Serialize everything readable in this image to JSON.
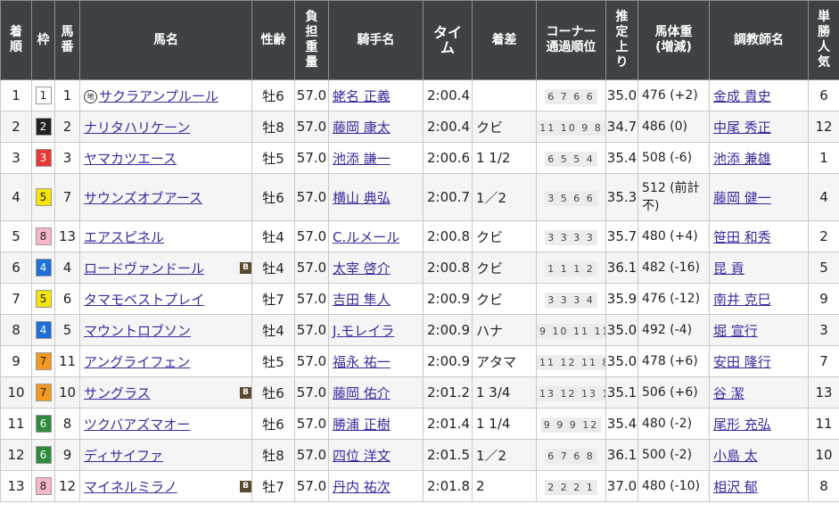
{
  "headers": {
    "finish": "着\n順",
    "waku": "枠",
    "number": "馬\n番",
    "horse": "馬名",
    "sexage": "性齢",
    "burden": "負\n担\n重\n量",
    "jockey": "騎手名",
    "time": "タイ\nム",
    "margin": "着差",
    "corner": "コーナー\n通過順位",
    "last3f": "推\n定\n上\nり",
    "bodyweight": "馬体重\n(増減)",
    "trainer": "調教師名",
    "pop": "単\n勝\n人\n気"
  },
  "icons": {
    "blinker_label": "B",
    "chihou_label": "地"
  },
  "waku_colors": {
    "1": {
      "bg": "#ffffff",
      "fg": "#222222"
    },
    "2": {
      "bg": "#222222",
      "fg": "#ffffff"
    },
    "3": {
      "bg": "#e53935",
      "fg": "#ffffff"
    },
    "4": {
      "bg": "#1e6fd9",
      "fg": "#ffffff"
    },
    "5": {
      "bg": "#f5e30a",
      "fg": "#222222"
    },
    "6": {
      "bg": "#2e8b3c",
      "fg": "#ffffff"
    },
    "7": {
      "bg": "#f39a1e",
      "fg": "#222222"
    },
    "8": {
      "bg": "#f7b7c6",
      "fg": "#222222"
    }
  },
  "rows": [
    {
      "finish": "1",
      "waku": "1",
      "num": "1",
      "horse": "サクラアンプルール",
      "chihou": true,
      "blinker": false,
      "sexage": "牡6",
      "burden": "57.0",
      "jockey": "蛯名 正義",
      "time": "2:00.4",
      "margin": "",
      "corner": "6 7 6 6",
      "last3f": "35.0",
      "bw": "476 (+2)",
      "trainer": "金成 貴史",
      "pop": "6"
    },
    {
      "finish": "2",
      "waku": "2",
      "num": "2",
      "horse": "ナリタハリケーン",
      "chihou": false,
      "blinker": false,
      "sexage": "牡8",
      "burden": "57.0",
      "jockey": "藤岡 康太",
      "time": "2:00.4",
      "margin": "クビ",
      "corner": "11 10 9 8",
      "last3f": "34.7",
      "bw": "486 (0)",
      "trainer": "中尾 秀正",
      "pop": "12"
    },
    {
      "finish": "3",
      "waku": "3",
      "num": "3",
      "horse": "ヤマカツエース",
      "chihou": false,
      "blinker": false,
      "sexage": "牡5",
      "burden": "57.0",
      "jockey": "池添 謙一",
      "time": "2:00.6",
      "margin": "1 1/2",
      "corner": "6 5 5 4",
      "last3f": "35.4",
      "bw": "508 (-6)",
      "trainer": "池添 兼雄",
      "pop": "1"
    },
    {
      "finish": "4",
      "waku": "5",
      "num": "7",
      "horse": "サウンズオブアース",
      "chihou": false,
      "blinker": false,
      "sexage": "牡6",
      "burden": "57.0",
      "jockey": "横山 典弘",
      "time": "2:00.7",
      "margin": "1／2",
      "corner": "3 5 6 6",
      "last3f": "35.3",
      "bw": "512 (前計不)",
      "trainer": "藤岡 健一",
      "pop": "4"
    },
    {
      "finish": "5",
      "waku": "8",
      "num": "13",
      "horse": "エアスピネル",
      "chihou": false,
      "blinker": false,
      "sexage": "牡4",
      "burden": "57.0",
      "jockey": "C.ルメール",
      "time": "2:00.8",
      "margin": "クビ",
      "corner": "3 3 3 3",
      "last3f": "35.7",
      "bw": "480 (+4)",
      "trainer": "笹田 和秀",
      "pop": "2"
    },
    {
      "finish": "6",
      "waku": "4",
      "num": "4",
      "horse": "ロードヴァンドール",
      "chihou": false,
      "blinker": true,
      "sexage": "牡4",
      "burden": "57.0",
      "jockey": "太宰 啓介",
      "time": "2:00.8",
      "margin": "クビ",
      "corner": "1 1 1 2",
      "last3f": "36.1",
      "bw": "482 (-16)",
      "trainer": "昆 貢",
      "pop": "5"
    },
    {
      "finish": "7",
      "waku": "5",
      "num": "6",
      "horse": "タマモベストプレイ",
      "chihou": false,
      "blinker": false,
      "sexage": "牡7",
      "burden": "57.0",
      "jockey": "吉田 隼人",
      "time": "2:00.9",
      "margin": "クビ",
      "corner": "3 3 3 4",
      "last3f": "35.9",
      "bw": "476 (-12)",
      "trainer": "南井 克巳",
      "pop": "9"
    },
    {
      "finish": "8",
      "waku": "4",
      "num": "5",
      "horse": "マウントロブソン",
      "chihou": false,
      "blinker": false,
      "sexage": "牡4",
      "burden": "57.0",
      "jockey": "J.モレイラ",
      "time": "2:00.9",
      "margin": "ハナ",
      "corner": "9 10 11 11",
      "last3f": "35.0",
      "bw": "492 (-4)",
      "trainer": "堀 宣行",
      "pop": "3"
    },
    {
      "finish": "9",
      "waku": "7",
      "num": "11",
      "horse": "アングライフェン",
      "chihou": false,
      "blinker": false,
      "sexage": "牡5",
      "burden": "57.0",
      "jockey": "福永 祐一",
      "time": "2:00.9",
      "margin": "アタマ",
      "corner": "11 12 11 8",
      "last3f": "35.0",
      "bw": "478 (+6)",
      "trainer": "安田 隆行",
      "pop": "7"
    },
    {
      "finish": "10",
      "waku": "7",
      "num": "10",
      "horse": "サングラス",
      "chihou": false,
      "blinker": true,
      "sexage": "牡6",
      "burden": "57.0",
      "jockey": "藤岡 佑介",
      "time": "2:01.2",
      "margin": "1 3/4",
      "corner": "13 12 13 12",
      "last3f": "35.1",
      "bw": "506 (+6)",
      "trainer": "谷 潔",
      "pop": "13"
    },
    {
      "finish": "11",
      "waku": "6",
      "num": "8",
      "horse": "ツクバアズマオー",
      "chihou": false,
      "blinker": false,
      "sexage": "牡6",
      "burden": "57.0",
      "jockey": "勝浦 正樹",
      "time": "2:01.4",
      "margin": "1 1/4",
      "corner": "9 9 9 12",
      "last3f": "35.4",
      "bw": "480 (-2)",
      "trainer": "尾形 充弘",
      "pop": "11"
    },
    {
      "finish": "12",
      "waku": "6",
      "num": "9",
      "horse": "ディサイファ",
      "chihou": false,
      "blinker": false,
      "sexage": "牡8",
      "burden": "57.0",
      "jockey": "四位 洋文",
      "time": "2:01.5",
      "margin": "1／2",
      "corner": "6 7 6 8",
      "last3f": "36.1",
      "bw": "500 (-2)",
      "trainer": "小島 太",
      "pop": "10"
    },
    {
      "finish": "13",
      "waku": "8",
      "num": "12",
      "horse": "マイネルミラノ",
      "chihou": false,
      "blinker": true,
      "sexage": "牡7",
      "burden": "57.0",
      "jockey": "丹内 祐次",
      "time": "2:01.8",
      "margin": "2",
      "corner": "2 2 2 1",
      "last3f": "37.0",
      "bw": "480 (-10)",
      "trainer": "相沢 郁",
      "pop": "8"
    }
  ]
}
